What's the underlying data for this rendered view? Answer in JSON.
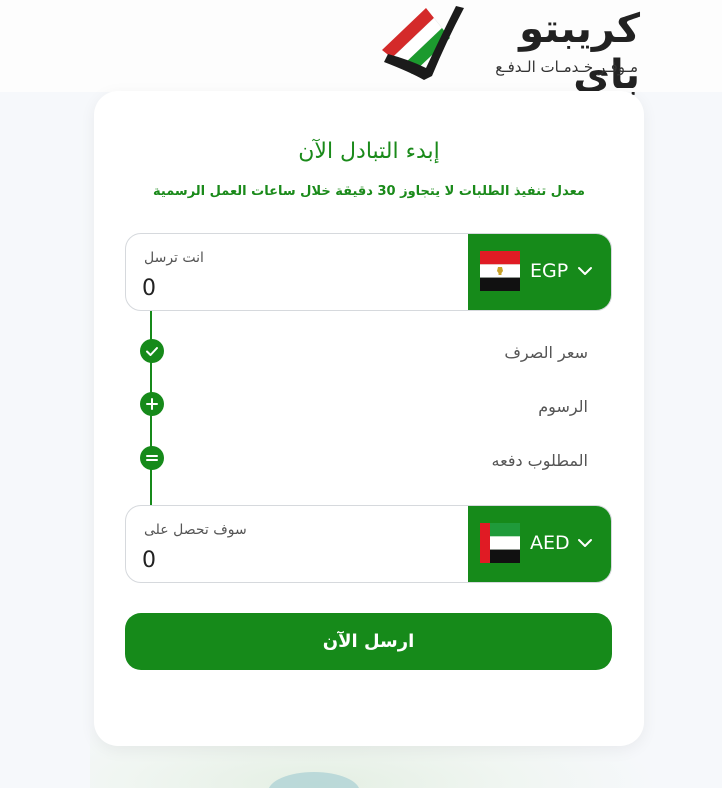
{
  "brand": {
    "name": "كريبتو باي",
    "tagline": "مـوفـر خـدمـات الـدفـع"
  },
  "exchange": {
    "title": "إبدء التبادل الآن",
    "subtitle": "معدل تنفيذ الطلبات لا يتجاوز 30 دقيقة خلال ساعات العمل الرسمية",
    "send": {
      "label": "انت ترسل",
      "value": "0",
      "currency": "EGP",
      "flag_icon": "egypt-flag-icon"
    },
    "steps": [
      {
        "label": "سعر الصرف",
        "icon": "check-icon"
      },
      {
        "label": "الرسوم",
        "icon": "plus-icon"
      },
      {
        "label": "المطلوب دفعه",
        "icon": "equals-icon"
      }
    ],
    "receive": {
      "label": "سوف تحصل على",
      "value": "0",
      "currency": "AED",
      "flag_icon": "uae-flag-icon"
    },
    "submit_label": "ارسل الآن"
  },
  "colors": {
    "accent": "#168a1a",
    "card": "#ffffff",
    "background": "#f6f8fb"
  }
}
